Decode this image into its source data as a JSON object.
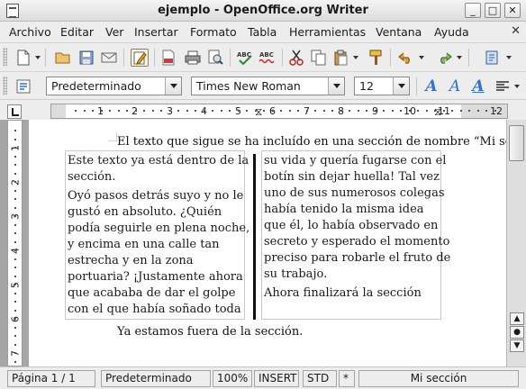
{
  "window": {
    "title": "ejemplo - OpenOffice.org Writer"
  },
  "menu": {
    "items": [
      "Archivo",
      "Editar",
      "Ver",
      "Insertar",
      "Formato",
      "Tabla",
      "Herramientas",
      "Ventana",
      "Ayuda"
    ]
  },
  "toolbar": {
    "icons": [
      "new-document",
      "open",
      "save",
      "email",
      "edit-mode",
      "export-pdf",
      "print",
      "print-preview",
      "spellcheck",
      "autospellcheck",
      "cut",
      "copy",
      "paste",
      "format-paintbrush",
      "undo",
      "redo",
      "navigator"
    ]
  },
  "formatting": {
    "style": "Predeterminado",
    "font": "Times New Roman",
    "size": "12"
  },
  "ruler": {
    "numbers": [
      "1",
      "2",
      "3",
      "4",
      "5",
      "6",
      "7",
      "8",
      "9",
      "10",
      "11",
      "12"
    ],
    "vertical_numbers": [
      "1",
      "2",
      "3",
      "4",
      "5",
      "6",
      "7"
    ]
  },
  "document": {
    "intro_line": "El texto que sigue se ha incluído en una sección de nombre “Mi secc",
    "left_column": [
      "Este texto ya está dentro de la",
      "sección.",
      "Oyó pasos detrás suyo y no le",
      "gustó en absoluto. ¿Quién",
      "podía seguirle en plena noche,",
      "y encima en una calle tan",
      "estrecha y en la zona",
      "portuaria? ¡Justamente ahora",
      "que acababa de dar el golpe",
      "con el que había soñado toda"
    ],
    "right_column": [
      "su vida y quería fugarse con el",
      "botín sin dejar huella! Tal vez",
      "uno de sus numerosos colegas",
      "había tenido la misma idea",
      "que él, lo había observado en",
      "secreto y esperado el momento",
      "preciso para robarle el fruto de",
      "su trabajo.",
      "Ahora finalizará la sección"
    ],
    "after_line": "Ya estamos fuera de la sección."
  },
  "status": {
    "page": "Página  1 / 1",
    "style": "Predeterminado",
    "zoom": "100%",
    "insert_mode": "INSERT",
    "selection_mode": "STD",
    "modified": "*",
    "section": "Mi sección"
  }
}
